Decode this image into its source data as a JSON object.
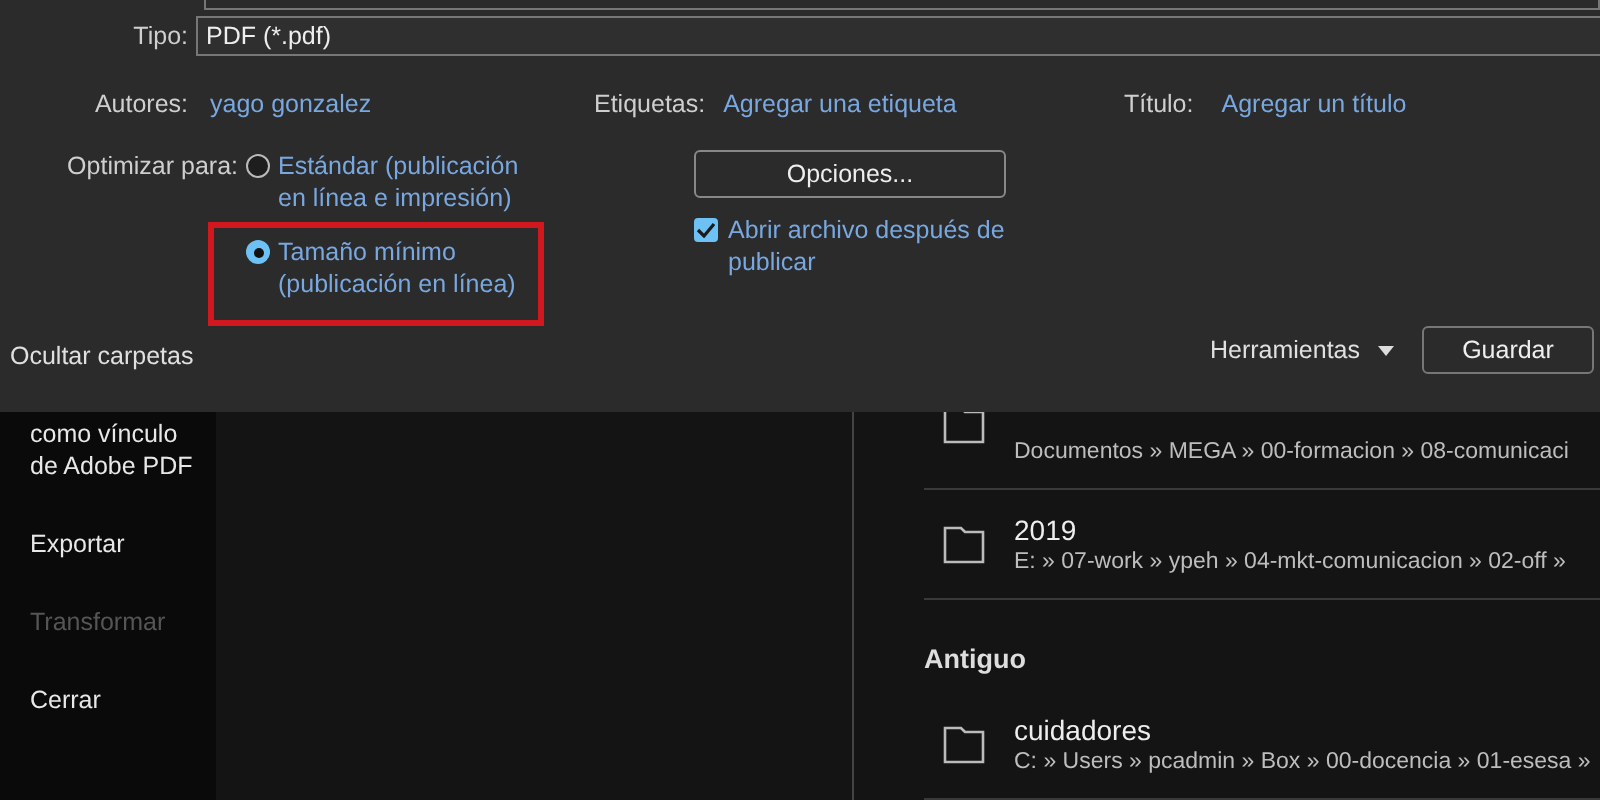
{
  "dialog": {
    "type": {
      "label": "Tipo:",
      "value": "PDF (*.pdf)"
    },
    "meta": [
      {
        "label": "Autores:",
        "value": "yago gonzalez"
      },
      {
        "label": "Etiquetas:",
        "value": "Agregar una etiqueta"
      },
      {
        "label": "Título:",
        "value": "Agregar un título"
      }
    ],
    "optimize": {
      "label": "Optimizar para:",
      "options": [
        {
          "text": "Estándar (publicación en línea e impresión)",
          "selected": false,
          "highlighted": false
        },
        {
          "text": "Tamaño mínimo (publicación en línea)",
          "selected": true,
          "highlighted": true
        }
      ]
    },
    "options_button": "Opciones...",
    "open_after": {
      "text": "Abrir archivo después de publicar",
      "checked": true
    },
    "hide_folders": "Ocultar carpetas",
    "tools": "Herramientas",
    "save_button": "Guardar"
  },
  "sidebar": {
    "items": [
      {
        "label": "como vínculo de Adobe PDF",
        "disabled": false
      },
      {
        "label": "Exportar",
        "disabled": false
      },
      {
        "label": "Transformar",
        "disabled": true
      },
      {
        "label": "Cerrar",
        "disabled": false
      }
    ]
  },
  "folders": [
    {
      "kind": "folder",
      "path": "Documentos » MEGA » 00-formacion » 08-comunicaci"
    },
    {
      "kind": "folder",
      "name": "2019",
      "path": "E: » 07-work » ypeh » 04-mkt-comunicacion » 02-off »"
    },
    {
      "kind": "heading",
      "name": "Antiguo"
    },
    {
      "kind": "folder",
      "name": "cuidadores",
      "path": "C: » Users » pcadmin » Box » 00-docencia » 01-esesa »"
    }
  ]
}
